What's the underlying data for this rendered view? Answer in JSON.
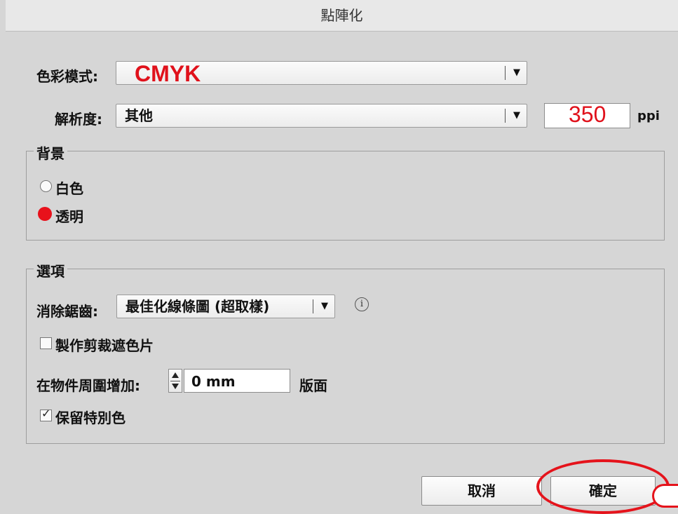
{
  "window": {
    "title": "點陣化"
  },
  "color_mode": {
    "label": "色彩模式:",
    "value": "CMYK"
  },
  "resolution": {
    "label": "解析度:",
    "value": "其他",
    "custom_value": "350",
    "unit": "ppi"
  },
  "background": {
    "legend": "背景",
    "options": [
      {
        "label": "白色",
        "selected": false
      },
      {
        "label": "透明",
        "selected": true
      }
    ]
  },
  "options": {
    "legend": "選項",
    "antialias": {
      "label": "消除鋸齒:",
      "value": "最佳化線條圖 (超取樣)"
    },
    "clipping_mask": {
      "label": "製作剪裁遮色片",
      "checked": false
    },
    "add_around": {
      "label": "在物件周圍增加:",
      "value": "0 mm",
      "suffix": "版面"
    },
    "preserve_spot": {
      "label": "保留特別色",
      "checked": true
    }
  },
  "buttons": {
    "cancel": "取消",
    "ok": "確定"
  },
  "colors": {
    "highlight": "#e5131b",
    "dialog_bg": "#d6d6d6"
  },
  "icons": {
    "info": "info-icon",
    "dropdown": "chevron-down-icon"
  }
}
